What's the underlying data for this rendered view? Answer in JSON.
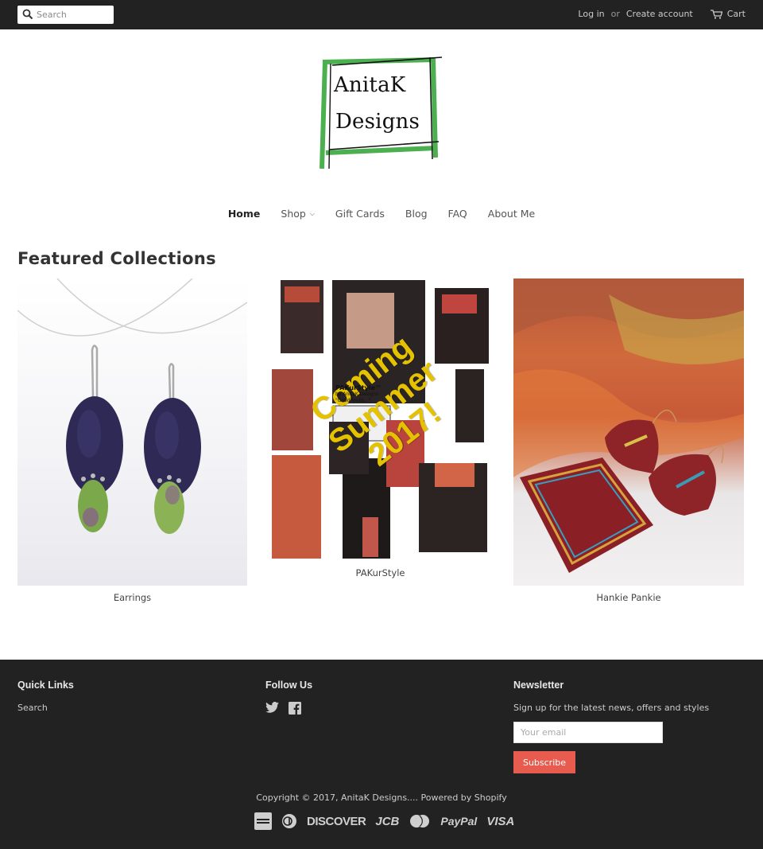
{
  "header": {
    "search_placeholder": "Search",
    "login_label": "Log in",
    "or_label": "or",
    "create_account_label": "Create account",
    "cart_label": "Cart"
  },
  "logo": {
    "line1": "AnitaK",
    "line2": "Designs"
  },
  "nav": {
    "items": [
      {
        "label": "Home",
        "active": true
      },
      {
        "label": "Shop",
        "has_dropdown": true
      },
      {
        "label": "Gift Cards"
      },
      {
        "label": "Blog"
      },
      {
        "label": "FAQ"
      },
      {
        "label": "About Me"
      }
    ]
  },
  "featured": {
    "title": "Featured Collections",
    "collections": [
      {
        "name": "Earrings"
      },
      {
        "name": "PAKurStyle",
        "overlay_text": [
          "Coming",
          "Summer",
          "2017!"
        ],
        "badge_title": "PAKurStyle™",
        "badge_sub": "by AnitaK Designs",
        "badge_tag": "\"Good looks...\""
      },
      {
        "name": "Hankie Pankie"
      }
    ]
  },
  "footer": {
    "quick_links_title": "Quick Links",
    "quick_links": [
      "Search"
    ],
    "follow_title": "Follow Us",
    "social_icons": [
      "twitter-icon",
      "facebook-icon"
    ],
    "newsletter_title": "Newsletter",
    "newsletter_text": "Sign up for the latest news, offers and styles",
    "email_placeholder": "Your email",
    "subscribe_label": "Subscribe",
    "copyright": "Copyright © 2017, AnitaK Designs.... Powered by Shopify",
    "payment_methods": [
      "American Express",
      "Diners",
      "DISCOVER",
      "JCB",
      "MasterCard",
      "PayPal",
      "VISA"
    ]
  },
  "colors": {
    "topbar_bg": "#222222",
    "footer_bg": "#222222",
    "accent": "#e85c50",
    "logo_green": "#4caf50"
  }
}
